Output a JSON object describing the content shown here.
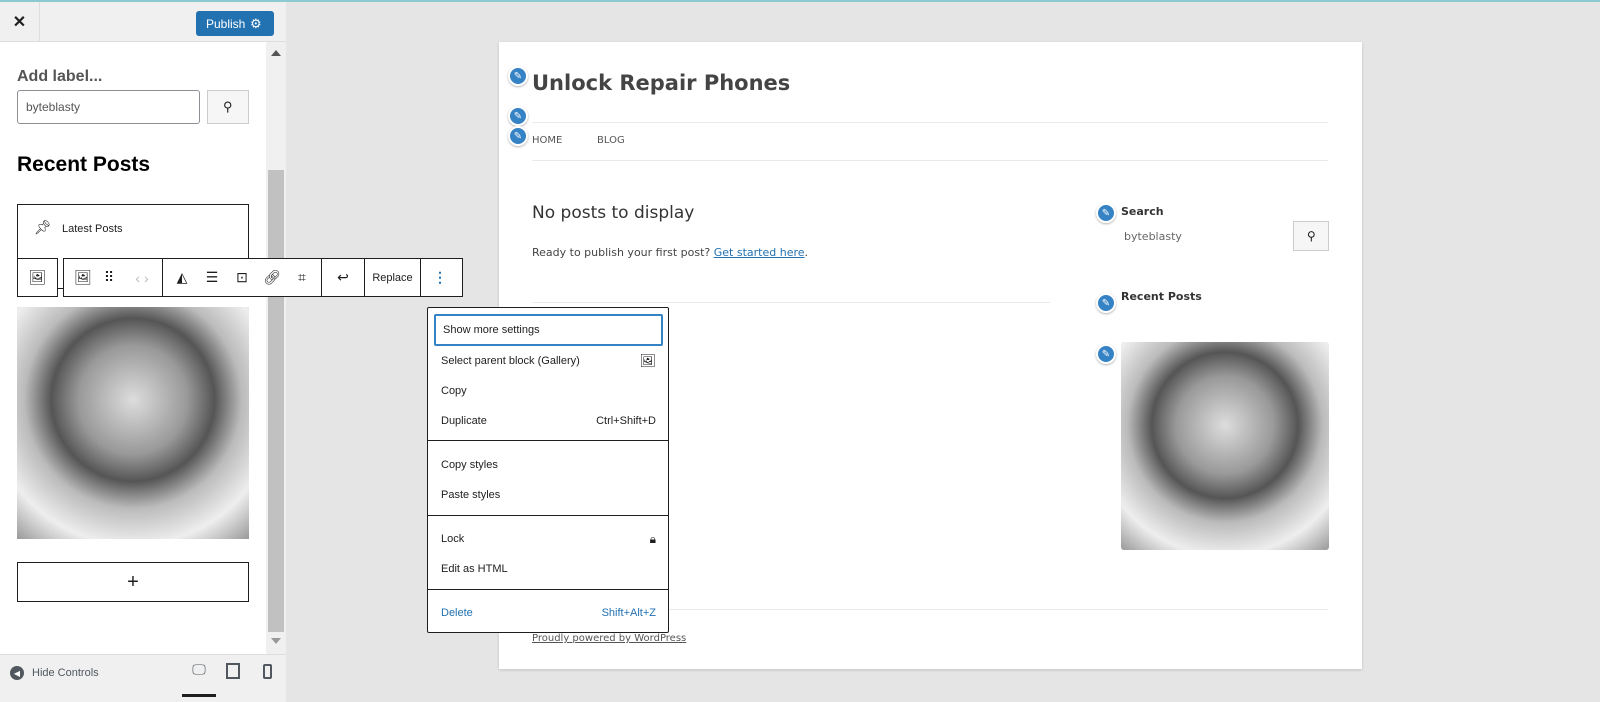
{
  "editor": {
    "close_label": "✕",
    "publish_label": "Publish",
    "add_label": "Add label...",
    "search_value": "byteblasty",
    "recent_posts_heading": "Recent Posts",
    "latest_posts_label": "Latest Posts",
    "add_block": "+",
    "hide_controls": "Hide Controls",
    "replace_label": "Replace"
  },
  "context_menu": {
    "items": [
      {
        "label": "Show more settings",
        "shortcut": ""
      },
      {
        "label": "Select parent block (Gallery)",
        "shortcut": ""
      },
      {
        "label": "Copy",
        "shortcut": ""
      },
      {
        "label": "Duplicate",
        "shortcut": "Ctrl+Shift+D"
      },
      {
        "label": "Copy styles",
        "shortcut": ""
      },
      {
        "label": "Paste styles",
        "shortcut": ""
      },
      {
        "label": "Lock",
        "shortcut": ""
      },
      {
        "label": "Edit as HTML",
        "shortcut": ""
      },
      {
        "label": "Delete",
        "shortcut": "Shift+Alt+Z"
      }
    ]
  },
  "preview": {
    "site_title": "Unlock Repair Phones",
    "nav": [
      "HOME",
      "BLOG"
    ],
    "no_posts": "No posts to display",
    "ready_text": "Ready to publish your first post?",
    "get_started": "Get started here",
    "period": ".",
    "search_heading": "Search",
    "search_value": "byteblasty",
    "recent_posts": "Recent Posts",
    "footer": "Proudly powered by WordPress"
  },
  "colors": {
    "accent": "#2271b1",
    "pencil": "#3582c4"
  }
}
